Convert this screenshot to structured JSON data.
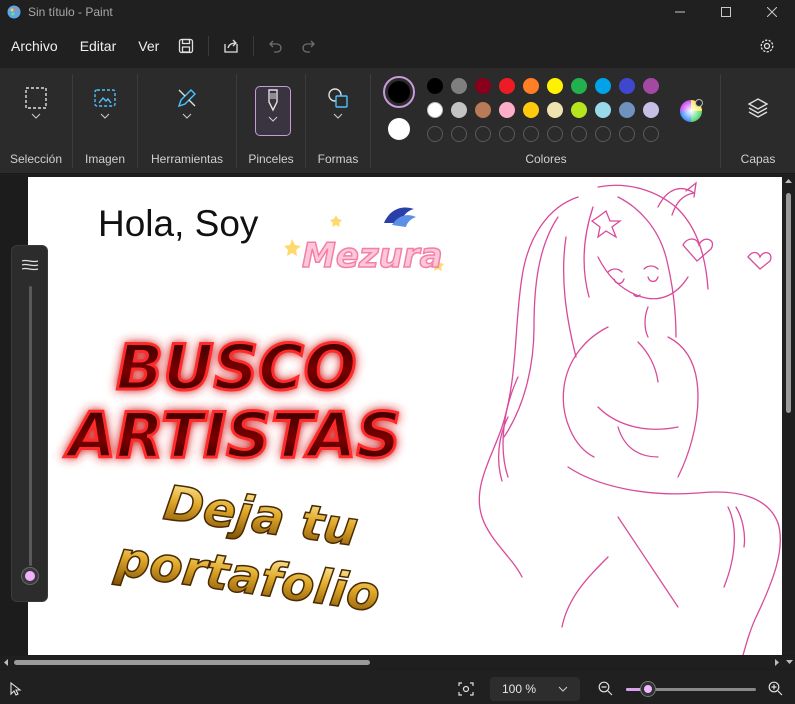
{
  "window": {
    "title": "Sin título - Paint"
  },
  "menu": {
    "file": "Archivo",
    "edit": "Editar",
    "view": "Ver"
  },
  "ribbon": {
    "selection": "Selección",
    "image": "Imagen",
    "tools": "Herramientas",
    "brushes": "Pinceles",
    "shapes": "Formas",
    "colors": "Colores",
    "layers": "Capas"
  },
  "colors": {
    "primary": "#000000",
    "secondary": "#ffffff",
    "row1": [
      "#000000",
      "#7f7f7f",
      "#88001b",
      "#ed1c24",
      "#ff7f27",
      "#fff200",
      "#22b14c",
      "#00a2e8",
      "#3f48cc",
      "#a349a4"
    ],
    "row2": [
      "#ffffff",
      "#c3c3c3",
      "#b97a57",
      "#ffaec9",
      "#ffc90e",
      "#efe4b0",
      "#b5e61d",
      "#99d9ea",
      "#7092be",
      "#c8bfe7"
    ],
    "accent": "#c79ad8"
  },
  "canvas": {
    "greeting": "Hola, Soy",
    "logo": "Mezura",
    "headline1": "BUSCO",
    "headline2": "ARTISTAS",
    "sub1": "Deja tu",
    "sub2": "portafolio"
  },
  "status": {
    "zoom": "100 %",
    "zoom_level": 0.17
  }
}
